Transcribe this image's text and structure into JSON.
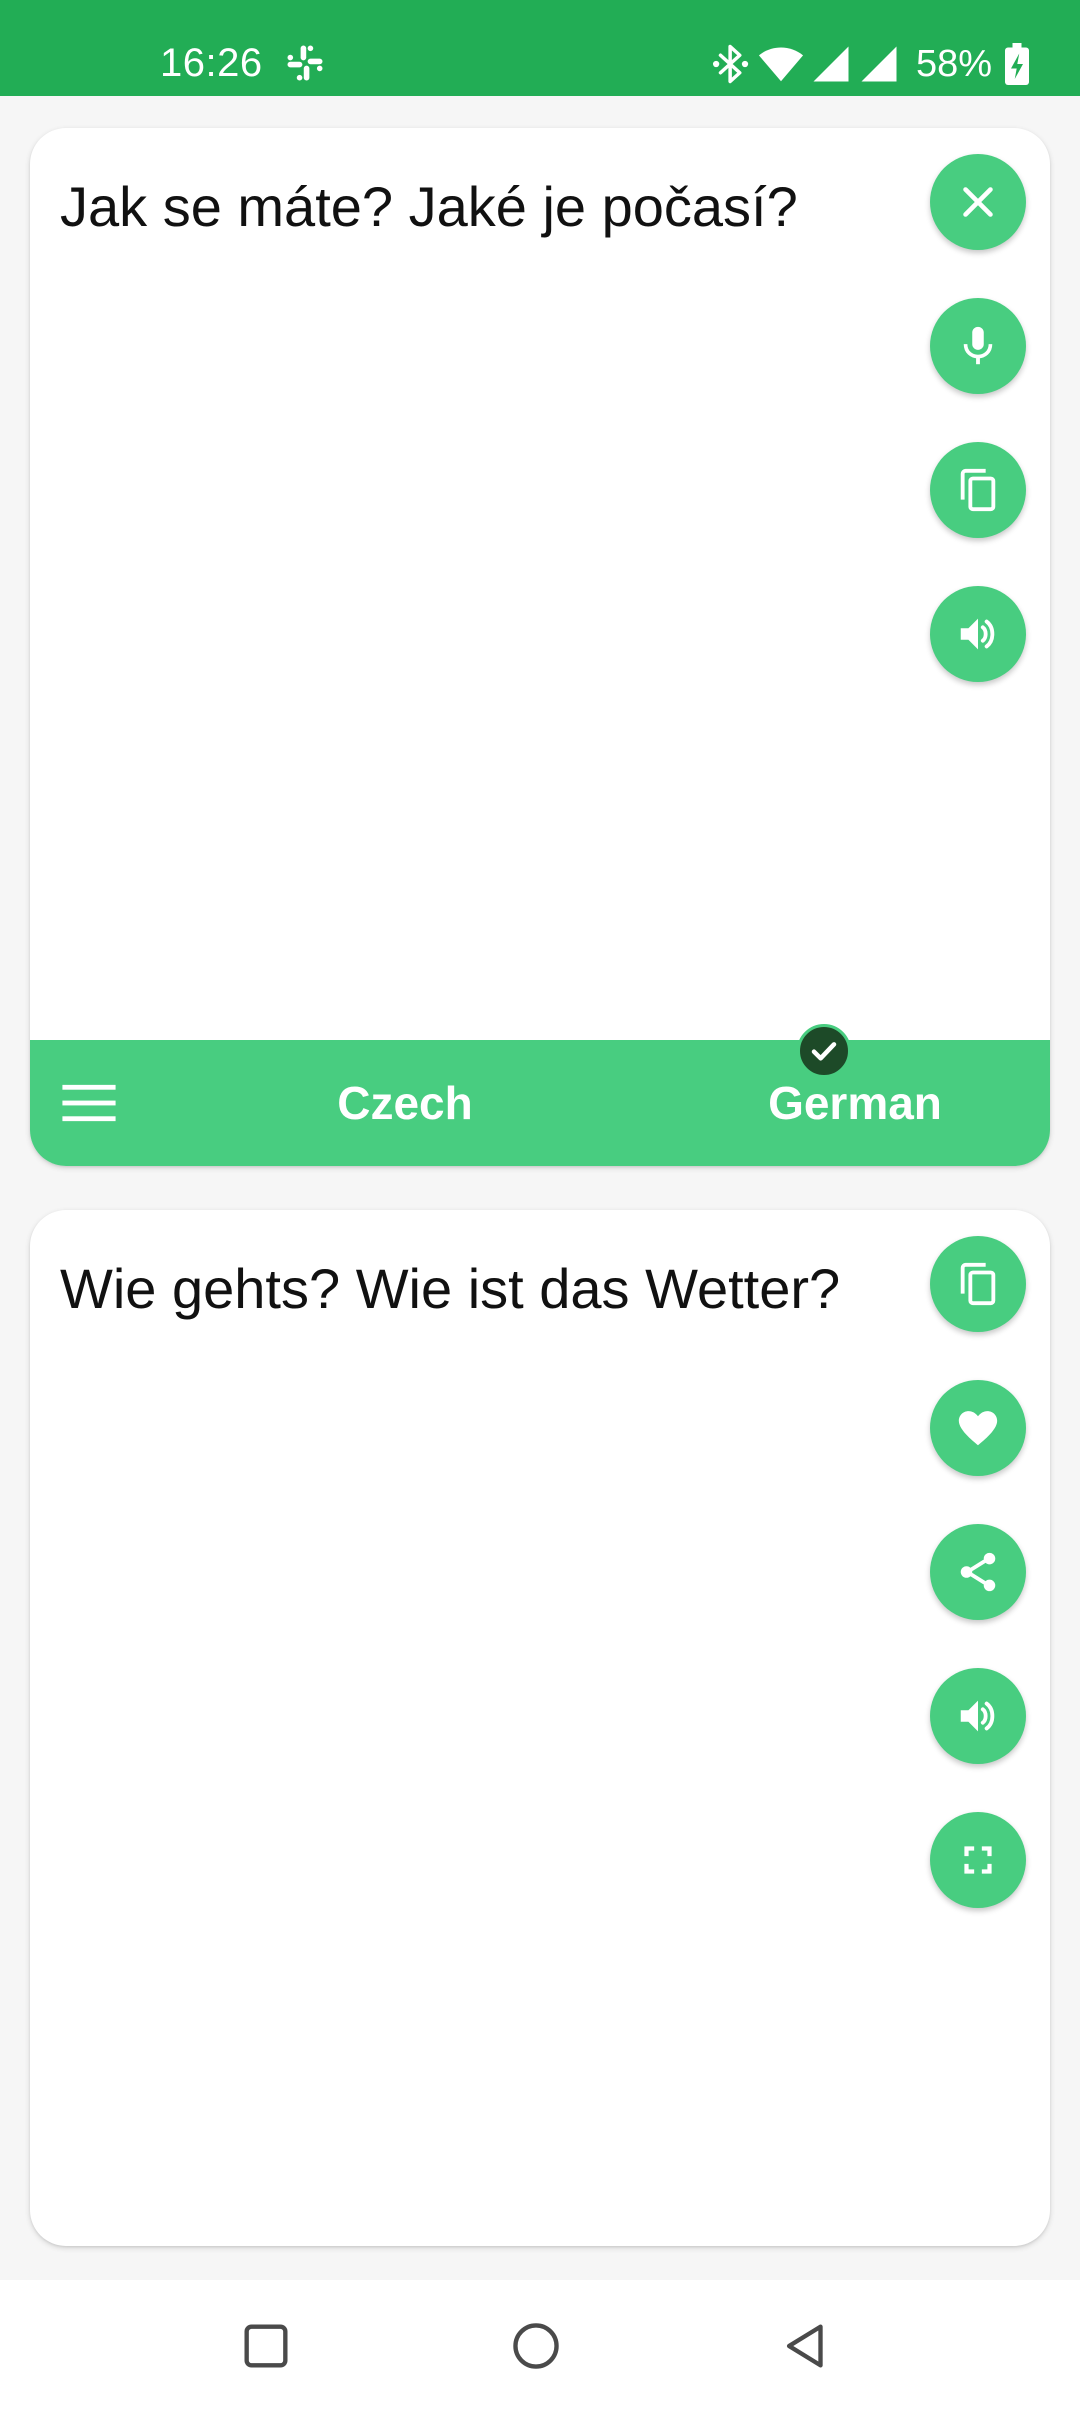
{
  "status_bar": {
    "time": "16:26",
    "notification_icons": [
      "slack-icon"
    ],
    "system_icons": [
      "bluetooth-icon",
      "wifi-icon",
      "signal-icon",
      "signal-icon"
    ],
    "battery_percent": "58%",
    "color": "#22ad55"
  },
  "source_panel": {
    "text": "Jak se máte? Jaké je počasí?",
    "actions": [
      "close-icon",
      "mic-icon",
      "copy-icon",
      "volume-icon"
    ]
  },
  "language_bar": {
    "source_language": "Czech",
    "target_language": "German",
    "selected": "target",
    "color": "#48cd80"
  },
  "target_panel": {
    "text": "Wie gehts? Wie ist das Wetter?",
    "actions": [
      "copy-icon",
      "heart-icon",
      "share-icon",
      "volume-icon",
      "fullscreen-icon"
    ]
  },
  "nav_bar": {
    "buttons": [
      "recents-icon",
      "home-icon",
      "back-icon"
    ]
  },
  "colors": {
    "accent": "#48cd80",
    "status_bar": "#22ad55",
    "check_badge": "#1d4a28"
  }
}
